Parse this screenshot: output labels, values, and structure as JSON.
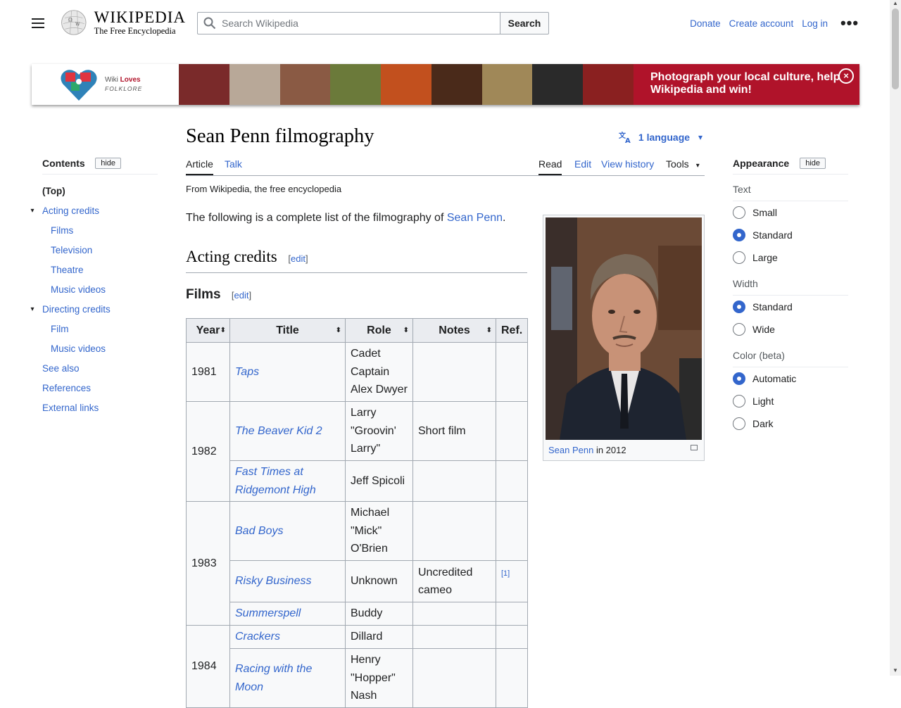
{
  "header": {
    "menu_icon": "hamburger-menu-icon",
    "logo": {
      "wordmark": "Wikipedia",
      "tagline": "The Free Encyclopedia"
    },
    "search": {
      "placeholder": "Search Wikipedia",
      "value": "",
      "button_label": "Search"
    },
    "user_links": [
      "Donate",
      "Create account",
      "Log in"
    ],
    "more_label": "•••"
  },
  "banner": {
    "logo_line1": "Wiki",
    "logo_line1_bold": "Loves",
    "logo_line2": "FOLKLORE",
    "cta": "Photograph your local culture, help Wikipedia and win!",
    "close_label": "×",
    "strip_colors": [
      "#7a2a2a",
      "#b8a898",
      "#8a5a44",
      "#6b7a3a",
      "#c2501e",
      "#4a2a1a",
      "#a08858",
      "#2a2a2a",
      "#8a2020"
    ]
  },
  "page": {
    "title": "Sean Penn filmography",
    "language_button": "1 language",
    "tabs": {
      "article": "Article",
      "talk": "Talk",
      "read": "Read",
      "edit": "Edit",
      "history": "View history",
      "tools": "Tools"
    },
    "from_line": "From Wikipedia, the free encyclopedia",
    "intro_prefix": "The following is a complete list of the filmography of ",
    "intro_link": "Sean Penn",
    "intro_suffix": ".",
    "h2": "Acting credits",
    "h3": "Films",
    "edit_label": "edit"
  },
  "toc": {
    "title": "Contents",
    "hide_label": "hide",
    "items": [
      {
        "label": "(Top)"
      },
      {
        "label": "Acting credits"
      },
      {
        "label": "Films"
      },
      {
        "label": "Television"
      },
      {
        "label": "Theatre"
      },
      {
        "label": "Music videos"
      },
      {
        "label": "Directing credits"
      },
      {
        "label": "Film"
      },
      {
        "label": "Music videos"
      },
      {
        "label": "See also"
      },
      {
        "label": "References"
      },
      {
        "label": "External links"
      }
    ]
  },
  "table": {
    "headers": [
      "Year",
      "Title",
      "Role",
      "Notes",
      "Ref."
    ],
    "rows": [
      {
        "year": "1981",
        "title": "Taps",
        "role": "Cadet Captain Alex Dwyer",
        "notes": "",
        "ref": ""
      },
      {
        "year": "1982",
        "title": "The Beaver Kid 2",
        "role": "Larry \"Groovin' Larry\"",
        "notes": "Short film",
        "ref": ""
      },
      {
        "year": "",
        "title": "Fast Times at Ridgemont High",
        "role": "Jeff Spicoli",
        "notes": "",
        "ref": ""
      },
      {
        "year": "1983",
        "title": "Bad Boys",
        "role": "Michael \"Mick\" O'Brien",
        "notes": "",
        "ref": ""
      },
      {
        "year": "",
        "title": "Risky Business",
        "role": "Unknown",
        "notes": "Uncredited cameo",
        "ref": "[1]"
      },
      {
        "year": "",
        "title": "Summerspell",
        "role": "Buddy",
        "notes": "",
        "ref": ""
      },
      {
        "year": "1984",
        "title": "Crackers",
        "role": "Dillard",
        "notes": "",
        "ref": ""
      },
      {
        "year": "",
        "title": "Racing with the Moon",
        "role": "Henry \"Hopper\" Nash",
        "notes": "",
        "ref": ""
      }
    ]
  },
  "infobox": {
    "caption_link": "Sean Penn",
    "caption_suffix": " in 2012",
    "colors": {
      "bg": "#6b4a36",
      "suit": "#1e2430",
      "skin": "#c89277",
      "hair": "#7a6a5a",
      "shirt": "#e8e6e6"
    }
  },
  "appearance": {
    "title": "Appearance",
    "hide_label": "hide",
    "text_group": "Text",
    "text_options": [
      "Small",
      "Standard",
      "Large"
    ],
    "text_selected": "Standard",
    "width_group": "Width",
    "width_options": [
      "Standard",
      "Wide"
    ],
    "width_selected": "Standard",
    "color_group": "Color (beta)",
    "color_options": [
      "Automatic",
      "Light",
      "Dark"
    ],
    "color_selected": "Automatic"
  },
  "colors": {
    "link": "#3366cc",
    "banner_red": "#b0132a",
    "text": "#202122"
  }
}
